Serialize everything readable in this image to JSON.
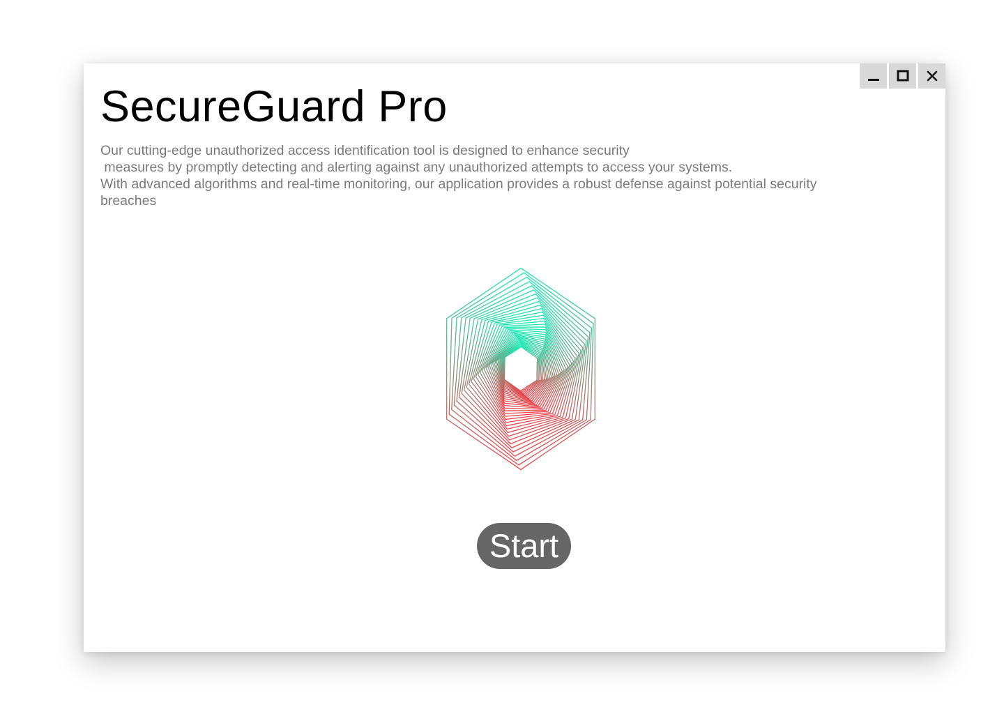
{
  "app": {
    "title": "SecureGuard Pro"
  },
  "window_controls": {
    "minimize_icon": "minimize-icon",
    "maximize_icon": "maximize-icon",
    "close_icon": "close-icon"
  },
  "description": {
    "lines": [
      "Our cutting-edge unauthorized access identification tool is designed to enhance security",
      " measures by promptly detecting and alerting against any unauthorized attempts to access your systems.",
      "With advanced algorithms and real-time monitoring, our application provides a robust defense against potential security",
      "breaches"
    ]
  },
  "logo": {
    "icon": "spiral-hexagon-logo",
    "color_top": "#1de9b6",
    "color_bottom": "#f0434b"
  },
  "start_button": {
    "label": "Start",
    "background": "#666666"
  }
}
